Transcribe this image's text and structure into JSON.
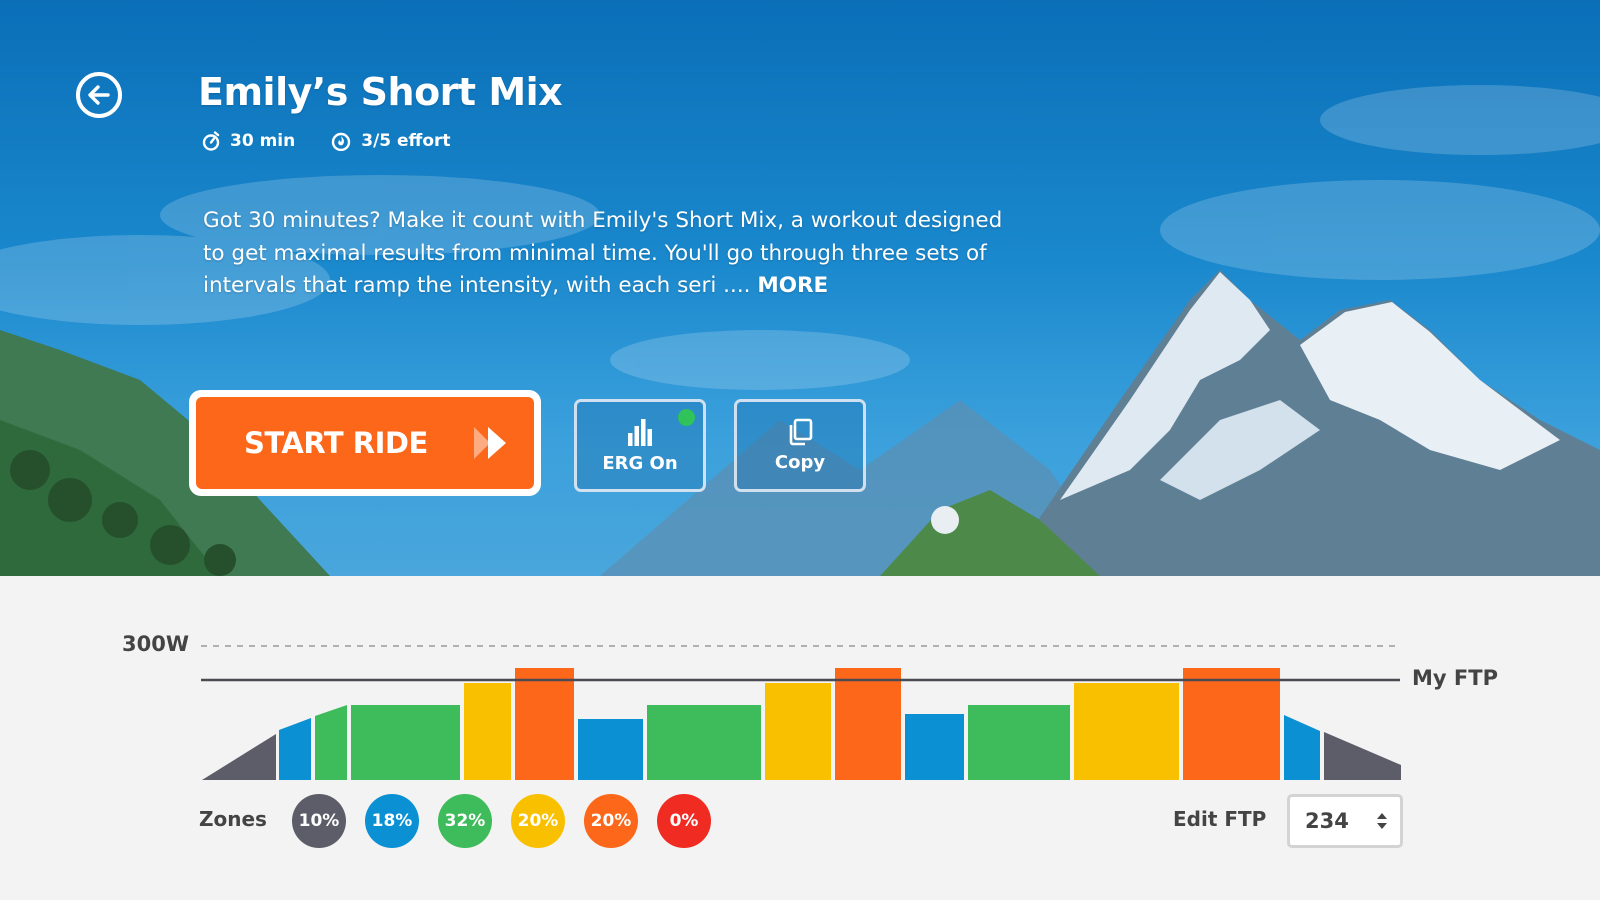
{
  "workout": {
    "title": "Emily’s Short Mix",
    "duration": "30 min",
    "effort": "3/5 effort",
    "description": "Got 30 minutes? Make it count with Emily's Short Mix, a workout designed to get maximal results from minimal time. You'll go through three sets of intervals that ramp the intensity, with each seri ....",
    "more_label": "MORE"
  },
  "actions": {
    "start_label": "START RIDE",
    "erg_label": "ERG On",
    "erg_active": true,
    "copy_label": "Copy"
  },
  "graph": {
    "max_label": "300W",
    "ftp_line_label": "My FTP",
    "zones_label": "Zones",
    "zones": [
      {
        "pct": "10%",
        "color": "#5d5d69"
      },
      {
        "pct": "18%",
        "color": "#0b90d4"
      },
      {
        "pct": "32%",
        "color": "#3ebb5a"
      },
      {
        "pct": "20%",
        "color": "#f9c000"
      },
      {
        "pct": "20%",
        "color": "#fc6719"
      },
      {
        "pct": "0%",
        "color": "#f02b22"
      }
    ]
  },
  "ftp": {
    "edit_label": "Edit FTP",
    "value": "234"
  },
  "colors": {
    "accent": "#fc6719",
    "hero_sky": "#1a88cd"
  }
}
